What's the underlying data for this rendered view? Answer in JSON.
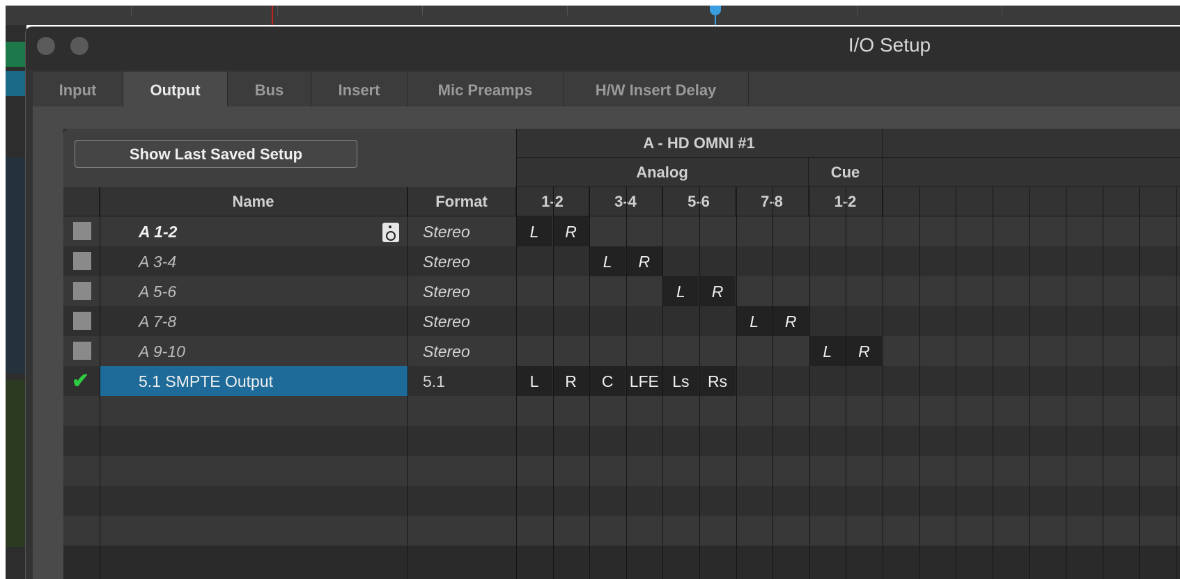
{
  "window": {
    "title": "I/O Setup"
  },
  "tabs": [
    {
      "label": "Input",
      "active": false
    },
    {
      "label": "Output",
      "active": true
    },
    {
      "label": "Bus",
      "active": false
    },
    {
      "label": "Insert",
      "active": false
    },
    {
      "label": "Mic Preamps",
      "active": false
    },
    {
      "label": "H/W Insert Delay",
      "active": false
    }
  ],
  "panel": {
    "show_last_saved_label": "Show Last Saved Setup",
    "device_header": "A - HD OMNI #1",
    "group_headers": {
      "analog": "Analog",
      "cue": "Cue"
    },
    "columns": {
      "name": "Name",
      "format": "Format"
    },
    "channel_pairs": [
      "1-2",
      "3-4",
      "5-6",
      "7-8",
      "1-2"
    ]
  },
  "rows": [
    {
      "name": "A 1-2",
      "format": "Stereo",
      "checked": false,
      "bold": true,
      "selected": false,
      "speaker_icon": true,
      "assign": [
        "L",
        "R",
        "",
        "",
        "",
        "",
        "",
        "",
        "",
        ""
      ]
    },
    {
      "name": "A 3-4",
      "format": "Stereo",
      "checked": false,
      "bold": false,
      "selected": false,
      "speaker_icon": false,
      "assign": [
        "",
        "",
        "L",
        "R",
        "",
        "",
        "",
        "",
        "",
        ""
      ]
    },
    {
      "name": "A 5-6",
      "format": "Stereo",
      "checked": false,
      "bold": false,
      "selected": false,
      "speaker_icon": false,
      "assign": [
        "",
        "",
        "",
        "",
        "L",
        "R",
        "",
        "",
        "",
        ""
      ]
    },
    {
      "name": "A 7-8",
      "format": "Stereo",
      "checked": false,
      "bold": false,
      "selected": false,
      "speaker_icon": false,
      "assign": [
        "",
        "",
        "",
        "",
        "",
        "",
        "L",
        "R",
        "",
        ""
      ]
    },
    {
      "name": "A 9-10",
      "format": "Stereo",
      "checked": false,
      "bold": false,
      "selected": false,
      "speaker_icon": false,
      "assign": [
        "",
        "",
        "",
        "",
        "",
        "",
        "",
        "",
        "L",
        "R"
      ]
    },
    {
      "name": "5.1 SMPTE Output",
      "format": "5.1",
      "checked": true,
      "bold": false,
      "selected": true,
      "speaker_icon": false,
      "assign": [
        "L",
        "R",
        "C",
        "LFE",
        "Ls",
        "Rs",
        "",
        "",
        "",
        ""
      ]
    }
  ],
  "empty_rows": 5,
  "colors": {
    "selection": "#1e6a98",
    "check": "#2ecc40",
    "playhead_red": "#c42020",
    "playhead_blue": "#3a9ee0"
  }
}
